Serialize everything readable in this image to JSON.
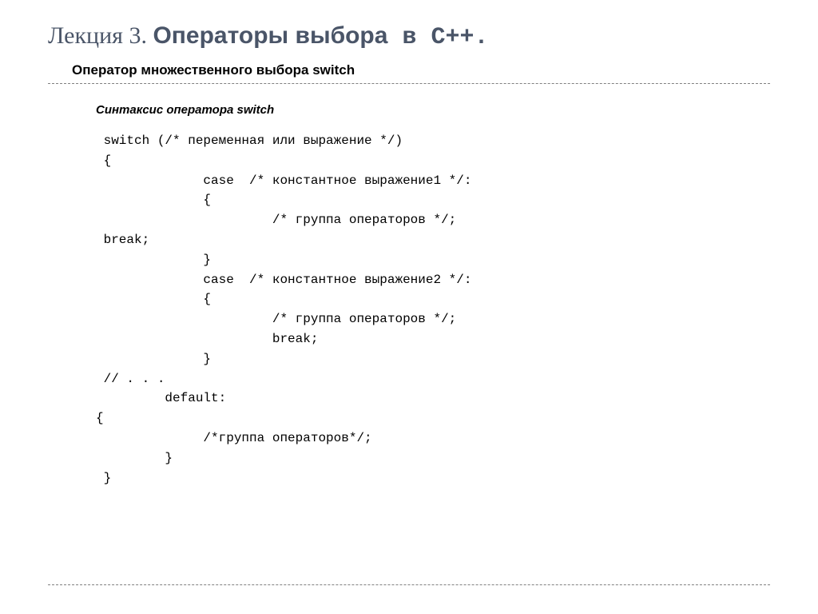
{
  "title": {
    "light": "Лекция 3. ",
    "bold": "Операторы выбора",
    "bold_mono": " в С++."
  },
  "subtitle": "Оператор множественного выбора switch",
  "syntax_title": "Синтаксис оператора switch",
  "code": " switch (/* переменная или выражение */)\n {\n              case  /* константное выражение1 */:\n              {\n                       /* группа операторов */;\n break;\n              }\n              case  /* константное выражение2 */:\n              {\n                       /* группа операторов */;\n                       break;\n              }\n // . . .\n         default:\n{\n              /*группа операторов*/;\n         }\n }"
}
